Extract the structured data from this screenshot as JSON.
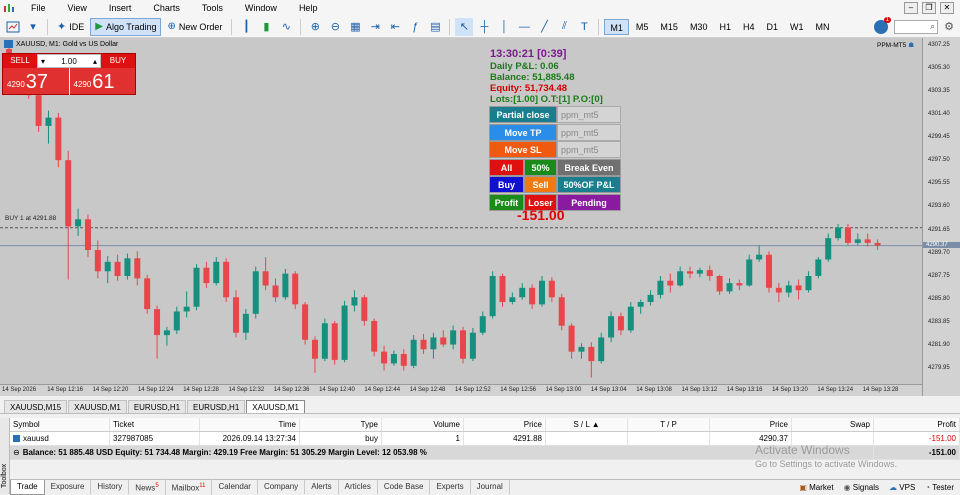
{
  "menu": [
    "File",
    "View",
    "Insert",
    "Charts",
    "Tools",
    "Window",
    "Help"
  ],
  "toolbar": {
    "ide_label": "IDE",
    "algo_label": "Algo Trading",
    "order_label": "New Order",
    "timeframes": [
      "M1",
      "M5",
      "M15",
      "M30",
      "H1",
      "H4",
      "D1",
      "W1",
      "MN"
    ],
    "selected_tf": "M1",
    "notifications": "1"
  },
  "chart": {
    "header": "XAUUSD, M1:  Gold vs US Dollar",
    "ea_tag": "PPM-MT5",
    "buy_line": "BUY 1 at 4291.88",
    "bid_label": "4290.37",
    "price_ticks": [
      "4307.25",
      "4305.30",
      "4303.35",
      "4301.40",
      "4299.45",
      "4297.50",
      "4295.55",
      "4293.60",
      "4291.65",
      "4290.37",
      "4289.70",
      "4287.75",
      "4285.80",
      "4283.85",
      "4281.90",
      "4279.95"
    ],
    "time_ticks": [
      "14 Sep 2026",
      "14 Sep 12:16",
      "14 Sep 12:20",
      "14 Sep 12:24",
      "14 Sep 12:28",
      "14 Sep 12:32",
      "14 Sep 12:36",
      "14 Sep 12:40",
      "14 Sep 12:44",
      "14 Sep 12:48",
      "14 Sep 12:52",
      "14 Sep 12:56",
      "14 Sep 13:00",
      "14 Sep 13:04",
      "14 Sep 13:08",
      "14 Sep 13:12",
      "14 Sep 13:16",
      "14 Sep 13:20",
      "14 Sep 13:24",
      "14 Sep 13:28"
    ]
  },
  "trade_panel": {
    "sell_label": "SELL",
    "buy_label": "BUY",
    "lot": "1.00",
    "sell_small": "4290",
    "sell_big": "37",
    "buy_small": "4290",
    "buy_big": "61"
  },
  "info": {
    "time": "13:30:21 [0:39]",
    "daily": "Daily P&L: 0.06",
    "balance": "Balance: 51,885.48",
    "equity": "Equity: 51,734.48",
    "lots": "Lots:[1.00] O.T:[1] P.O:[0]",
    "pl_big": "-151.00"
  },
  "ppm": {
    "partial_close": "Partial close",
    "move_tp": "Move TP",
    "move_sl": "Move SL",
    "field": "ppm_mt5",
    "all": "All",
    "fifty": "50%",
    "break_even": "Break Even",
    "buy": "Buy",
    "sell": "Sell",
    "fifty_pl": "50%OF P&L",
    "profit": "Profit",
    "loser": "Loser",
    "pending": "Pending"
  },
  "chart_tabs": [
    "XAUUSD,M15",
    "XAUUSD,M1",
    "EURUSD,H1",
    "EURUSD,H1",
    "XAUUSD,M1"
  ],
  "selected_chart_tab": 4,
  "table": {
    "headers": {
      "symbol": "Symbol",
      "ticket": "Ticket",
      "time": "Time",
      "type": "Type",
      "volume": "Volume",
      "price": "Price",
      "sl": "S / L",
      "tp": "T / P",
      "cur_price": "Price",
      "swap": "Swap",
      "profit": "Profit"
    },
    "row": {
      "symbol": "xauusd",
      "ticket": "327987085",
      "time": "2026.09.14 13:27:34",
      "type": "buy",
      "volume": "1",
      "price": "4291.88",
      "sl": "",
      "tp": "",
      "cur_price": "4290.37",
      "swap": "",
      "profit": "-151.00"
    },
    "summary": "Balance: 51 885.48 USD  Equity: 51 734.48  Margin: 429.19  Free Margin: 51 305.29  Margin Level: 12 053.98 %",
    "summary_profit": "-151.00"
  },
  "bottom_tabs": [
    {
      "label": "Trade",
      "badge": ""
    },
    {
      "label": "Exposure",
      "badge": ""
    },
    {
      "label": "History",
      "badge": ""
    },
    {
      "label": "News",
      "badge": "5"
    },
    {
      "label": "Mailbox",
      "badge": "11"
    },
    {
      "label": "Calendar",
      "badge": ""
    },
    {
      "label": "Company",
      "badge": ""
    },
    {
      "label": "Alerts",
      "badge": ""
    },
    {
      "label": "Articles",
      "badge": ""
    },
    {
      "label": "Code Base",
      "badge": ""
    },
    {
      "label": "Experts",
      "badge": ""
    },
    {
      "label": "Journal",
      "badge": ""
    }
  ],
  "status": {
    "market": "Market",
    "signals": "Signals",
    "vps": "VPS",
    "tester": "Tester",
    "toolbox": "Toolbox"
  },
  "watermark": {
    "title": "Activate Windows",
    "sub": "Go to Settings to activate Windows."
  },
  "candles": [
    {
      "o": 4307.0,
      "h": 4307.3,
      "l": 4305.8,
      "c": 4306.2
    },
    {
      "o": 4306.2,
      "h": 4306.4,
      "l": 4304.5,
      "c": 4304.8
    },
    {
      "o": 4304.8,
      "h": 4305.0,
      "l": 4302.8,
      "c": 4303.1
    },
    {
      "o": 4303.1,
      "h": 4303.5,
      "l": 4300.0,
      "c": 4300.5
    },
    {
      "o": 4300.5,
      "h": 4301.8,
      "l": 4299.0,
      "c": 4301.2
    },
    {
      "o": 4301.2,
      "h": 4301.6,
      "l": 4297.0,
      "c": 4297.6
    },
    {
      "o": 4297.6,
      "h": 4298.4,
      "l": 4287.5,
      "c": 4292.0
    },
    {
      "o": 4292.0,
      "h": 4293.5,
      "l": 4291.2,
      "c": 4292.6
    },
    {
      "o": 4292.6,
      "h": 4293.0,
      "l": 4289.4,
      "c": 4290.0
    },
    {
      "o": 4290.0,
      "h": 4290.8,
      "l": 4287.6,
      "c": 4288.2
    },
    {
      "o": 4288.2,
      "h": 4289.5,
      "l": 4287.2,
      "c": 4289.0
    },
    {
      "o": 4289.0,
      "h": 4289.6,
      "l": 4287.4,
      "c": 4287.8
    },
    {
      "o": 4287.8,
      "h": 4289.7,
      "l": 4287.5,
      "c": 4289.3
    },
    {
      "o": 4289.3,
      "h": 4289.9,
      "l": 4287.0,
      "c": 4287.6
    },
    {
      "o": 4287.6,
      "h": 4287.9,
      "l": 4284.6,
      "c": 4285.0
    },
    {
      "o": 4285.0,
      "h": 4285.3,
      "l": 4280.8,
      "c": 4282.8
    },
    {
      "o": 4282.8,
      "h": 4283.5,
      "l": 4281.9,
      "c": 4283.2
    },
    {
      "o": 4283.2,
      "h": 4285.2,
      "l": 4282.9,
      "c": 4284.8
    },
    {
      "o": 4284.8,
      "h": 4286.5,
      "l": 4284.3,
      "c": 4285.2
    },
    {
      "o": 4285.2,
      "h": 4288.8,
      "l": 4284.9,
      "c": 4288.5
    },
    {
      "o": 4288.5,
      "h": 4289.0,
      "l": 4286.8,
      "c": 4287.2
    },
    {
      "o": 4287.2,
      "h": 4289.4,
      "l": 4287.0,
      "c": 4289.0
    },
    {
      "o": 4289.0,
      "h": 4289.3,
      "l": 4285.6,
      "c": 4286.0
    },
    {
      "o": 4286.0,
      "h": 4286.6,
      "l": 4282.6,
      "c": 4283.0
    },
    {
      "o": 4283.0,
      "h": 4285.0,
      "l": 4282.4,
      "c": 4284.6
    },
    {
      "o": 4284.6,
      "h": 4288.6,
      "l": 4284.2,
      "c": 4288.2
    },
    {
      "o": 4288.2,
      "h": 4289.4,
      "l": 4286.6,
      "c": 4287.0
    },
    {
      "o": 4287.0,
      "h": 4287.6,
      "l": 4285.6,
      "c": 4286.0
    },
    {
      "o": 4286.0,
      "h": 4288.4,
      "l": 4285.8,
      "c": 4288.0
    },
    {
      "o": 4288.0,
      "h": 4288.2,
      "l": 4285.0,
      "c": 4285.4
    },
    {
      "o": 4285.4,
      "h": 4285.6,
      "l": 4282.0,
      "c": 4282.4
    },
    {
      "o": 4282.4,
      "h": 4282.7,
      "l": 4279.6,
      "c": 4280.8
    },
    {
      "o": 4280.8,
      "h": 4284.2,
      "l": 4280.6,
      "c": 4283.8
    },
    {
      "o": 4283.8,
      "h": 4284.0,
      "l": 4280.3,
      "c": 4280.7
    },
    {
      "o": 4280.7,
      "h": 4285.7,
      "l": 4280.5,
      "c": 4285.3
    },
    {
      "o": 4285.3,
      "h": 4286.6,
      "l": 4284.8,
      "c": 4286.0
    },
    {
      "o": 4286.0,
      "h": 4286.2,
      "l": 4283.6,
      "c": 4284.0
    },
    {
      "o": 4284.0,
      "h": 4284.2,
      "l": 4281.0,
      "c": 4281.4
    },
    {
      "o": 4281.4,
      "h": 4281.9,
      "l": 4279.8,
      "c": 4280.4
    },
    {
      "o": 4280.4,
      "h": 4281.5,
      "l": 4280.2,
      "c": 4281.2
    },
    {
      "o": 4281.2,
      "h": 4281.6,
      "l": 4279.8,
      "c": 4280.2
    },
    {
      "o": 4280.2,
      "h": 4282.8,
      "l": 4280.0,
      "c": 4282.4
    },
    {
      "o": 4282.4,
      "h": 4282.9,
      "l": 4281.2,
      "c": 4281.6
    },
    {
      "o": 4281.6,
      "h": 4283.0,
      "l": 4280.8,
      "c": 4282.6
    },
    {
      "o": 4282.6,
      "h": 4283.2,
      "l": 4281.8,
      "c": 4282.0
    },
    {
      "o": 4282.0,
      "h": 4283.6,
      "l": 4281.6,
      "c": 4283.2
    },
    {
      "o": 4283.2,
      "h": 4283.5,
      "l": 4280.4,
      "c": 4280.8
    },
    {
      "o": 4280.8,
      "h": 4283.4,
      "l": 4280.6,
      "c": 4283.0
    },
    {
      "o": 4283.0,
      "h": 4284.8,
      "l": 4282.8,
      "c": 4284.4
    },
    {
      "o": 4284.4,
      "h": 4288.2,
      "l": 4284.2,
      "c": 4287.8
    },
    {
      "o": 4287.8,
      "h": 4288.0,
      "l": 4285.2,
      "c": 4285.6
    },
    {
      "o": 4285.6,
      "h": 4286.4,
      "l": 4285.4,
      "c": 4286.0
    },
    {
      "o": 4286.0,
      "h": 4287.2,
      "l": 4285.8,
      "c": 4286.8
    },
    {
      "o": 4286.8,
      "h": 4287.1,
      "l": 4285.0,
      "c": 4285.4
    },
    {
      "o": 4285.4,
      "h": 4287.8,
      "l": 4285.2,
      "c": 4287.4
    },
    {
      "o": 4287.4,
      "h": 4287.7,
      "l": 4285.6,
      "c": 4286.0
    },
    {
      "o": 4286.0,
      "h": 4286.3,
      "l": 4283.2,
      "c": 4283.6
    },
    {
      "o": 4283.6,
      "h": 4283.8,
      "l": 4280.8,
      "c": 4281.4
    },
    {
      "o": 4281.4,
      "h": 4282.1,
      "l": 4280.8,
      "c": 4281.8
    },
    {
      "o": 4281.8,
      "h": 4282.2,
      "l": 4279.2,
      "c": 4280.6
    },
    {
      "o": 4280.6,
      "h": 4283.0,
      "l": 4280.4,
      "c": 4282.6
    },
    {
      "o": 4282.6,
      "h": 4284.8,
      "l": 4282.2,
      "c": 4284.4
    },
    {
      "o": 4284.4,
      "h": 4284.7,
      "l": 4282.8,
      "c": 4283.2
    },
    {
      "o": 4283.2,
      "h": 4285.6,
      "l": 4283.0,
      "c": 4285.2
    },
    {
      "o": 4285.2,
      "h": 4285.8,
      "l": 4284.6,
      "c": 4285.6
    },
    {
      "o": 4285.6,
      "h": 4286.6,
      "l": 4285.3,
      "c": 4286.2
    },
    {
      "o": 4286.2,
      "h": 4287.8,
      "l": 4285.9,
      "c": 4287.4
    },
    {
      "o": 4287.4,
      "h": 4288.0,
      "l": 4286.4,
      "c": 4287.0
    },
    {
      "o": 4287.0,
      "h": 4288.6,
      "l": 4286.9,
      "c": 4288.2
    },
    {
      "o": 4288.2,
      "h": 4288.6,
      "l": 4287.6,
      "c": 4288.0
    },
    {
      "o": 4288.0,
      "h": 4288.5,
      "l": 4287.7,
      "c": 4288.3
    },
    {
      "o": 4288.3,
      "h": 4288.7,
      "l": 4287.4,
      "c": 4287.8
    },
    {
      "o": 4287.8,
      "h": 4287.9,
      "l": 4286.2,
      "c": 4286.5
    },
    {
      "o": 4286.5,
      "h": 4287.6,
      "l": 4286.3,
      "c": 4287.2
    },
    {
      "o": 4287.2,
      "h": 4287.5,
      "l": 4286.6,
      "c": 4287.0
    },
    {
      "o": 4287.0,
      "h": 4289.6,
      "l": 4286.9,
      "c": 4289.2
    },
    {
      "o": 4289.2,
      "h": 4290.4,
      "l": 4289.0,
      "c": 4289.6
    },
    {
      "o": 4289.6,
      "h": 4289.9,
      "l": 4286.4,
      "c": 4286.8
    },
    {
      "o": 4286.8,
      "h": 4287.2,
      "l": 4285.6,
      "c": 4286.4
    },
    {
      "o": 4286.4,
      "h": 4287.4,
      "l": 4286.0,
      "c": 4287.0
    },
    {
      "o": 4287.0,
      "h": 4287.5,
      "l": 4285.8,
      "c": 4286.6
    },
    {
      "o": 4286.6,
      "h": 4288.2,
      "l": 4286.4,
      "c": 4287.8
    },
    {
      "o": 4287.8,
      "h": 4289.4,
      "l": 4287.6,
      "c": 4289.2
    },
    {
      "o": 4289.2,
      "h": 4291.4,
      "l": 4289.0,
      "c": 4291.0
    },
    {
      "o": 4291.0,
      "h": 4292.2,
      "l": 4290.8,
      "c": 4291.9
    },
    {
      "o": 4291.9,
      "h": 4292.2,
      "l": 4290.4,
      "c": 4290.6
    },
    {
      "o": 4290.6,
      "h": 4291.4,
      "l": 4290.4,
      "c": 4290.9
    },
    {
      "o": 4290.9,
      "h": 4291.4,
      "l": 4290.3,
      "c": 4290.6
    },
    {
      "o": 4290.6,
      "h": 4290.9,
      "l": 4290.0,
      "c": 4290.37
    }
  ],
  "buy_price": 4291.88,
  "bid_price": 4290.37
}
